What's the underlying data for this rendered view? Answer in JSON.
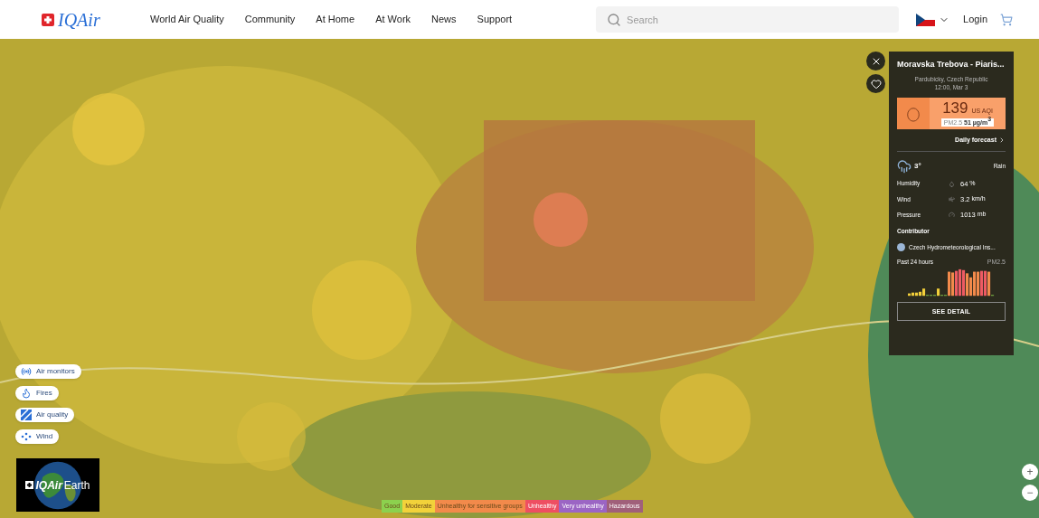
{
  "header": {
    "logo": "IQAir",
    "nav": [
      "World Air Quality",
      "Community",
      "At Home",
      "At Work",
      "News",
      "Support"
    ],
    "search": {
      "placeholder": "Search"
    },
    "login": "Login"
  },
  "map": {
    "kind": "picture"
  },
  "layers": [
    {
      "label": "Air monitors"
    },
    {
      "label": "Fires"
    },
    {
      "label": "Air quality"
    },
    {
      "label": "Wind"
    }
  ],
  "earth_logo": {
    "brand": "IQAir",
    "suffix": "Earth"
  },
  "legend": [
    {
      "label": "Good",
      "color": "#8cd14e"
    },
    {
      "label": "Moderate",
      "color": "#f2d23a"
    },
    {
      "label": "Unhealthy for sensitive groups",
      "color": "#f28a4b"
    },
    {
      "label": "Unhealthy",
      "color": "#ee4f62"
    },
    {
      "label": "Very unhealthy",
      "color": "#9b65c4"
    },
    {
      "label": "Hazardous",
      "color": "#a0607a"
    }
  ],
  "station": {
    "title": "Moravska Trebova - Piaris...",
    "location": "Pardubicky, Czech Republic",
    "time": "12:00, Mar 3",
    "aqi": "139",
    "aqi_unit": "US AQI",
    "pollutant": "PM2.5",
    "concentration": "51 µg/m$^{3}$",
    "forecast_link": "Daily forecast",
    "temperature": "3°",
    "condition": "Rain",
    "stats": [
      {
        "label": "Humidity",
        "value": "64",
        "unit": "%"
      },
      {
        "label": "Wind",
        "value": "3.2",
        "unit": "km/h"
      },
      {
        "label": "Pressure",
        "value": "1013",
        "unit": "mb"
      }
    ],
    "contributor_heading": "Contributor",
    "contributor": "Czech Hydrometeorological Ins...",
    "history_label": "Past 24 hours",
    "history_pollutant": "PM2.5",
    "detail_button": "SEE DETAIL"
  },
  "zoom": [
    "+",
    "−"
  ]
}
